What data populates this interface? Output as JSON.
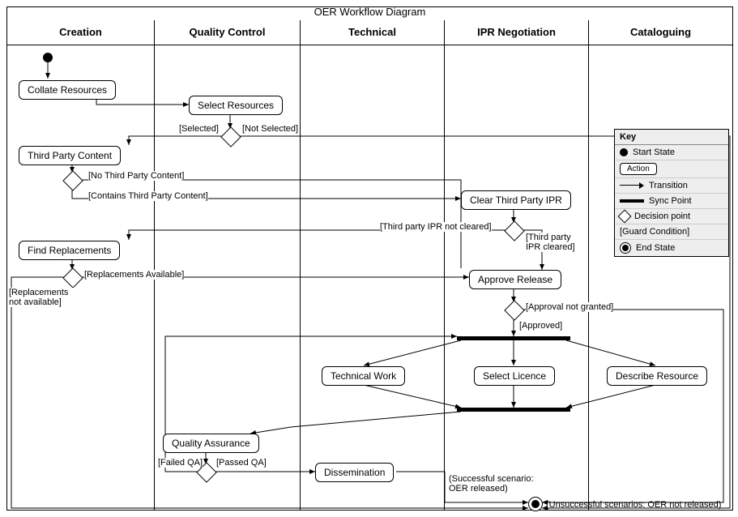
{
  "title": "OER Workflow Diagram",
  "lanes": [
    "Creation",
    "Quality Control",
    "Technical",
    "IPR Negotiation",
    "Cataloguing"
  ],
  "actions": {
    "collate": "Collate Resources",
    "select": "Select Resources",
    "thirdParty": "Third Party Content",
    "clearIPR": "Clear Third Party IPR",
    "findReplacements": "Find Replacements",
    "approve": "Approve Release",
    "technical": "Technical Work",
    "selectLicence": "Select Licence",
    "describe": "Describe Resource",
    "qa": "Quality Assurance",
    "dissemination": "Dissemination"
  },
  "guards": {
    "selected": "[Selected]",
    "notSelected": "[Not Selected]",
    "noTPC": "[No Third Party Content]",
    "containsTPC": "[Contains Third Party Content]",
    "iprNotCleared": "[Third party IPR not cleared]",
    "iprCleared": "[Third party IPR cleared]",
    "replAvail": "[Replacements Available]",
    "replNotAvail": "[Replacements not available]",
    "approvalNotGranted": "[Approval not granted]",
    "approved": "[Approved]",
    "failedQA": "[Failed QA]",
    "passedQA": "[Passed QA]"
  },
  "notes": {
    "success": "(Successful scenario: OER released)",
    "unsuccessful": "(Unsuccessful scenarios: OER not released)"
  },
  "key": {
    "title": "Key",
    "startState": "Start State",
    "action": "Action",
    "transition": "Transition",
    "syncPoint": "Sync Point",
    "decisionPoint": "Decision point",
    "guardCondition": "[Guard Condition]",
    "endState": "End State"
  }
}
